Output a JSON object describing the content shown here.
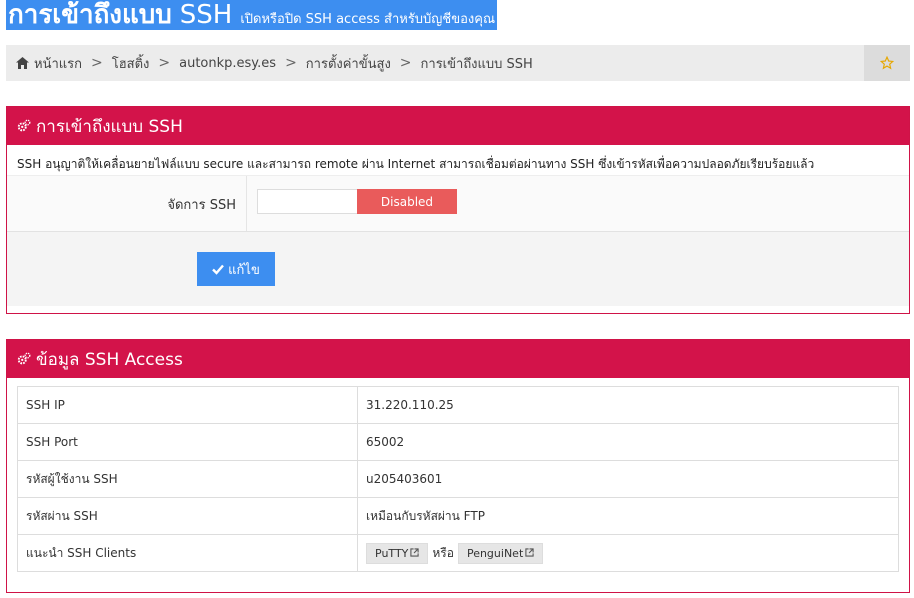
{
  "header": {
    "title_bold": "การเข้าถึงแบบ",
    "title_light": "SSH",
    "subtitle": "เปิดหรือปิด SSH access สำหรับบัญชีของคุณ"
  },
  "breadcrumb": {
    "home": "หน้าแรก",
    "hosting": "โฮสติ้ง",
    "domain": "autonkp.esy.es",
    "advanced": "การตั้งค่าขั้นสูง",
    "current": "การเข้าถึงแบบ SSH",
    "separator": ">"
  },
  "ssh_panel": {
    "title": "การเข้าถึงแบบ SSH",
    "description": "SSH อนุญาติให้เคลื่อนยายไฟล์แบบ secure และสามารถ remote ผ่าน Internet สามารถเชื่อมต่อผ่านทาง SSH ซึ่งเข้ารหัสเพื่อความปลอดภัยเรียบร้อยแล้ว",
    "manage_label": "จัดการ SSH",
    "toggle_state": "Disabled",
    "edit_button": "แก้ไข"
  },
  "info_panel": {
    "title": "ข้อมูล SSH Access",
    "rows": [
      {
        "label": "SSH IP",
        "value": "31.220.110.25"
      },
      {
        "label": "SSH Port",
        "value": "65002"
      },
      {
        "label": "รหัสผู้ใช้งาน SSH",
        "value": "u205403601"
      },
      {
        "label": "รหัสผ่าน SSH",
        "value": "เหมือนกับรหัสผ่าน FTP"
      },
      {
        "label": "แนะนำ SSH Clients",
        "value": ""
      }
    ],
    "clients": {
      "putty": "PuTTY",
      "or": "หรือ",
      "penguinet": "PenguiNet"
    }
  },
  "colors": {
    "accent_blue": "#3d8ef0",
    "panel_red": "#d3134a",
    "disabled_red": "#e95b5b",
    "star": "#e6a700"
  },
  "icons": {
    "home": "home-icon",
    "star": "star-icon",
    "cog": "cog-icon",
    "check": "check-icon",
    "external": "external-link-icon"
  }
}
